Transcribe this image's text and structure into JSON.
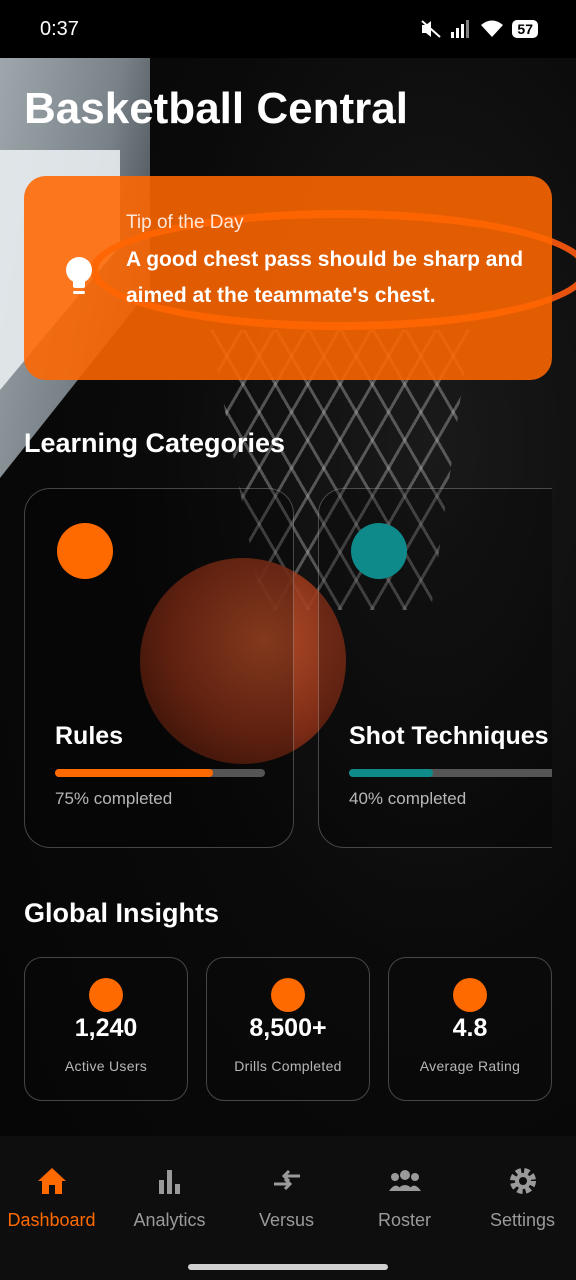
{
  "status_bar": {
    "time": "0:37",
    "battery": "57"
  },
  "app": {
    "title": "Basketball Central"
  },
  "tip": {
    "label": "Tip of the Day",
    "text": "A good chest pass should be sharp and aimed at the teammate's chest."
  },
  "categories_section": {
    "title": "Learning Categories",
    "items": [
      {
        "title": "Rules",
        "progress_text": "75% completed",
        "progress": 0.75,
        "color": "#ff6a00"
      },
      {
        "title": "Shot Techniques",
        "progress_text": "40% completed",
        "progress": 0.4,
        "color": "#0e8a8a"
      }
    ]
  },
  "insights_section": {
    "title": "Global Insights",
    "stats": [
      {
        "value": "1,240",
        "label": "Active Users"
      },
      {
        "value": "8,500+",
        "label": "Drills Completed"
      },
      {
        "value": "4.8",
        "label": "Average Rating"
      }
    ]
  },
  "bottom_nav": {
    "items": [
      {
        "label": "Dashboard",
        "icon": "home-icon",
        "active": true
      },
      {
        "label": "Analytics",
        "icon": "bar-chart-icon",
        "active": false
      },
      {
        "label": "Versus",
        "icon": "compare-arrows-icon",
        "active": false
      },
      {
        "label": "Roster",
        "icon": "group-icon",
        "active": false
      },
      {
        "label": "Settings",
        "icon": "gear-icon",
        "active": false
      }
    ]
  },
  "colors": {
    "accent": "#ff6a00",
    "teal": "#0e8a8a",
    "nav_inactive": "#9a9a9a"
  }
}
